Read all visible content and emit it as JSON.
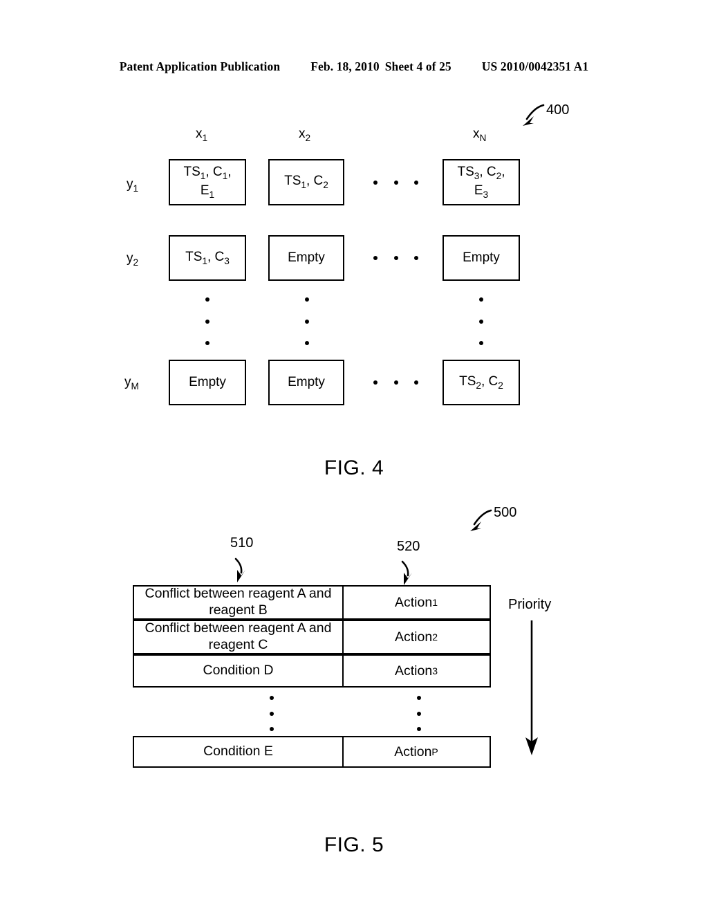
{
  "header": {
    "publication": "Patent Application Publication",
    "date": "Feb. 18, 2010",
    "sheet": "Sheet 4 of 25",
    "patent_number": "US 2010/0042351 A1"
  },
  "figure4": {
    "caption": "FIG. 4",
    "reference": "400",
    "column_labels": [
      "x",
      "x",
      "x"
    ],
    "column_subscripts": [
      "1",
      "2",
      "N"
    ],
    "row_labels": [
      "y",
      "y",
      "y"
    ],
    "row_subscripts": [
      "1",
      "2",
      "M"
    ],
    "cells": [
      {
        "line1": "TS",
        "sub1": "1",
        "mid": ", C",
        "sub2": "1",
        "tail": ",",
        "line2": "E",
        "sub3": "1"
      },
      {
        "text": "TS",
        "sub1": "1",
        "mid": ", C",
        "sub2": "2"
      },
      {
        "line1": "TS",
        "sub1": "3",
        "mid": ", C",
        "sub2": "2",
        "tail": ",",
        "line2": "E",
        "sub3": "3"
      },
      {
        "text": "TS",
        "sub1": "1",
        "mid": ", C",
        "sub2": "3"
      },
      {
        "text": "Empty"
      },
      {
        "text": "Empty"
      },
      {
        "text": "Empty"
      },
      {
        "text": "Empty"
      },
      {
        "text": "TS",
        "sub1": "2",
        "mid": ", C",
        "sub2": "2"
      }
    ],
    "cell_row1": [
      {
        "l1a": "TS",
        "l1s": "1",
        "l1b": ", C",
        "l1s2": "1",
        "l1c": ",",
        "l2a": "E",
        "l2s": "1"
      },
      {
        "l1a": "TS",
        "l1s": "1",
        "l1b": ", C",
        "l1s2": "2"
      },
      {
        "l1a": "TS",
        "l1s": "3",
        "l1b": ", C",
        "l1s2": "2",
        "l1c": ",",
        "l2a": "E",
        "l2s": "3"
      }
    ],
    "cell_row2": [
      {
        "l1a": "TS",
        "l1s": "1",
        "l1b": ", C",
        "l1s2": "3"
      },
      {
        "plain": "Empty"
      },
      {
        "plain": "Empty"
      }
    ],
    "cell_row3": [
      {
        "plain": "Empty"
      },
      {
        "plain": "Empty"
      },
      {
        "l1a": "TS",
        "l1s": "2",
        "l1b": ", C",
        "l1s2": "2"
      }
    ]
  },
  "figure5": {
    "caption": "FIG. 5",
    "reference": "500",
    "condition_column_ref": "510",
    "action_column_ref": "520",
    "priority_label": "Priority",
    "rows": [
      {
        "condition": "Conflict between reagent A and reagent B",
        "action": "Action",
        "action_sub": "1"
      },
      {
        "condition": "Conflict between reagent A and reagent C",
        "action": "Action",
        "action_sub": "2"
      },
      {
        "condition": "Condition D",
        "action": "Action",
        "action_sub": "3"
      },
      {
        "condition": "Condition E",
        "action": "Action",
        "action_sub": "P"
      }
    ]
  }
}
